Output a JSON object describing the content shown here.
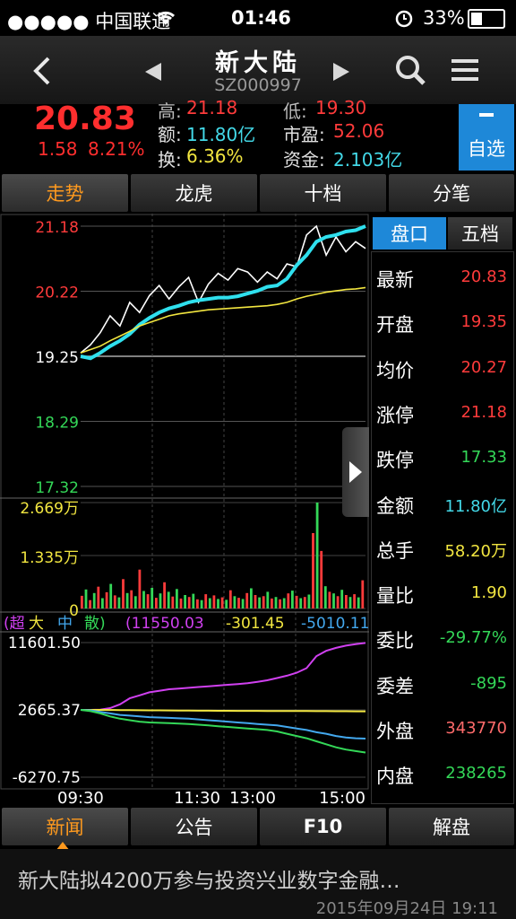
{
  "status_bar": {
    "carrier": "●●●●● 中国联通",
    "time": "01:46",
    "battery": "33%"
  },
  "nav": {
    "title": "新大陆",
    "code": "SZ000997"
  },
  "quote": {
    "price": "20.83",
    "change": "1.58",
    "change_pct": "8.21%",
    "high_label": "高:",
    "high": "21.18",
    "low_label": "低:",
    "low": "19.30",
    "amount_label": "额:",
    "amount": "11.80亿",
    "pe_label": "市盈:",
    "pe": "52.06",
    "turnover_label": "换:",
    "turnover": "6.36%",
    "capital_label": "资金:",
    "capital": "2.103亿",
    "watch_label": "自选"
  },
  "tabs": [
    {
      "label": "走势"
    },
    {
      "label": "龙虎"
    },
    {
      "label": "十档"
    },
    {
      "label": "分笔"
    }
  ],
  "side_tabs": [
    {
      "label": "盘口"
    },
    {
      "label": "五档"
    }
  ],
  "side_rows": [
    {
      "k": "最新",
      "v": "20.83",
      "color": "#ff3b3b"
    },
    {
      "k": "开盘",
      "v": "19.35",
      "color": "#ff3b3b"
    },
    {
      "k": "均价",
      "v": "20.27",
      "color": "#ff3b3b"
    },
    {
      "k": "涨停",
      "v": "21.18",
      "color": "#ff3b3b"
    },
    {
      "k": "跌停",
      "v": "17.33",
      "color": "#34d858"
    },
    {
      "k": "金额",
      "v": "11.80亿",
      "color": "#43d9e8"
    },
    {
      "k": "总手",
      "v": "58.20万",
      "color": "#f2e640"
    },
    {
      "k": "量比",
      "v": "1.90",
      "color": "#f2e640"
    },
    {
      "k": "委比",
      "v": "-29.77%",
      "color": "#34d858"
    },
    {
      "k": "委差",
      "v": "-895",
      "color": "#34d858"
    },
    {
      "k": "外盘",
      "v": "343770",
      "color": "#ff6b6b"
    },
    {
      "k": "内盘",
      "v": "238265",
      "color": "#34d858"
    }
  ],
  "chart_data": [
    {
      "type": "line",
      "y_ticks": [
        "21.18",
        "20.22",
        "19.25",
        "18.29",
        "17.32"
      ],
      "ylim": [
        17.32,
        21.18
      ],
      "series": [
        {
          "color": "#ffffff",
          "values": [
            19.3,
            19.42,
            19.6,
            19.85,
            19.7,
            20.05,
            19.9,
            20.15,
            20.3,
            20.1,
            20.28,
            20.42,
            20.05,
            20.32,
            20.48,
            20.38,
            20.55,
            20.5,
            20.35,
            20.5,
            20.4,
            20.62,
            20.58,
            21.05,
            21.18,
            20.75,
            21.02,
            20.8,
            20.95,
            20.85
          ]
        },
        {
          "color": "#2fe0ee",
          "values": [
            19.25,
            19.22,
            19.3,
            19.4,
            19.48,
            19.58,
            19.72,
            19.82,
            19.9,
            19.96,
            20.0,
            20.05,
            20.08,
            20.1,
            20.12,
            20.12,
            20.14,
            20.18,
            20.22,
            20.28,
            20.3,
            20.4,
            20.6,
            20.75,
            20.95,
            21.02,
            21.05,
            21.1,
            21.12,
            21.18
          ]
        },
        {
          "color": "#f2e640",
          "values": [
            19.3,
            19.35,
            19.4,
            19.48,
            19.55,
            19.62,
            19.7,
            19.75,
            19.8,
            19.85,
            19.88,
            19.9,
            19.92,
            19.94,
            19.95,
            19.96,
            19.97,
            19.98,
            19.99,
            20.0,
            20.02,
            20.05,
            20.1,
            20.14,
            20.17,
            20.2,
            20.22,
            20.24,
            20.25,
            20.27
          ]
        }
      ]
    },
    {
      "type": "bar",
      "y_ticks": [
        "2.669万",
        "1.335万",
        "0"
      ],
      "ylim": [
        0,
        26690
      ],
      "values": [
        3200,
        4800,
        2100,
        3900,
        5500,
        2600,
        4100,
        6200,
        3300,
        2800,
        7400,
        3900,
        4600,
        3100,
        9800,
        4400,
        3600,
        5200,
        2700,
        3800,
        6600,
        4200,
        3000,
        4900,
        2500,
        3400,
        2900,
        3700,
        2300,
        2100,
        3600,
        2600,
        3300,
        2400,
        2800,
        2200,
        4600,
        3100,
        2700,
        2400,
        3900,
        5100,
        3400,
        2800,
        3100,
        4200,
        2500,
        2900,
        2300,
        2600,
        3800,
        4500,
        3200,
        2600,
        2900,
        3500,
        19000,
        26690,
        14500,
        5600,
        4200,
        3800,
        3100,
        4700,
        3400,
        2900,
        3600,
        2800,
        7100
      ],
      "colors": [
        "#ff3b3b",
        "#34d858"
      ]
    },
    {
      "type": "line",
      "legend": [
        "(超",
        "大",
        "中",
        "散)"
      ],
      "legend_values": [
        "(11550.03",
        "-301.45",
        "-5010.11"
      ],
      "legend_colors": [
        "#d040f0",
        "#f2e640",
        "#43a8ee",
        "#34d858"
      ],
      "y_ticks": [
        "11601.50",
        "2665.37",
        "-6270.75"
      ],
      "ylim": [
        -6270.75,
        11601.5
      ],
      "x_ticks": [
        "09:30",
        "11:30",
        "13:00",
        "15:00"
      ],
      "series": [
        {
          "color": "#d040f0",
          "values": [
            2665,
            2665,
            2700,
            2900,
            3400,
            4200,
            4600,
            5000,
            5200,
            5400,
            5500,
            5600,
            5700,
            5800,
            5900,
            6000,
            6100,
            6200,
            6400,
            6600,
            6900,
            7200,
            7600,
            8200,
            9800,
            10500,
            10900,
            11200,
            11400,
            11550
          ]
        },
        {
          "color": "#f2e640",
          "values": [
            2665,
            2665,
            2660,
            2650,
            2640,
            2630,
            2620,
            2610,
            2600,
            2590,
            2580,
            2570,
            2560,
            2555,
            2550,
            2545,
            2540,
            2535,
            2530,
            2525,
            2520,
            2515,
            2510,
            2505,
            2500,
            2495,
            2490,
            2485,
            2480,
            2470
          ]
        },
        {
          "color": "#43a8ee",
          "values": [
            2665,
            2600,
            2400,
            2200,
            2000,
            1900,
            1800,
            1700,
            1650,
            1600,
            1550,
            1500,
            1400,
            1300,
            1200,
            1100,
            1000,
            900,
            800,
            700,
            600,
            400,
            200,
            0,
            -300,
            -500,
            -800,
            -1000,
            -1100,
            -1150
          ]
        },
        {
          "color": "#34d858",
          "values": [
            2665,
            2500,
            2200,
            1800,
            1500,
            1300,
            1100,
            1000,
            950,
            900,
            850,
            800,
            700,
            600,
            500,
            400,
            300,
            200,
            100,
            0,
            -200,
            -500,
            -800,
            -1100,
            -1500,
            -1900,
            -2300,
            -2600,
            -2800,
            -3000
          ]
        }
      ]
    }
  ],
  "bottom_tabs": [
    {
      "label": "新闻"
    },
    {
      "label": "公告"
    },
    {
      "label": "F10"
    },
    {
      "label": "解盘"
    }
  ],
  "news": {
    "headline": "新大陆拟4200万参与投资兴业数字金融…",
    "time": "2015年09月24日 19:11"
  },
  "icons": {
    "back": "back-chevron-icon",
    "prev": "prev-triangle-icon",
    "next": "next-triangle-icon",
    "search": "search-icon",
    "menu": "menu-icon",
    "wifi": "wifi-icon",
    "alarm": "alarm-icon",
    "battery": "battery-icon",
    "expand": "expand-arrow-icon"
  }
}
